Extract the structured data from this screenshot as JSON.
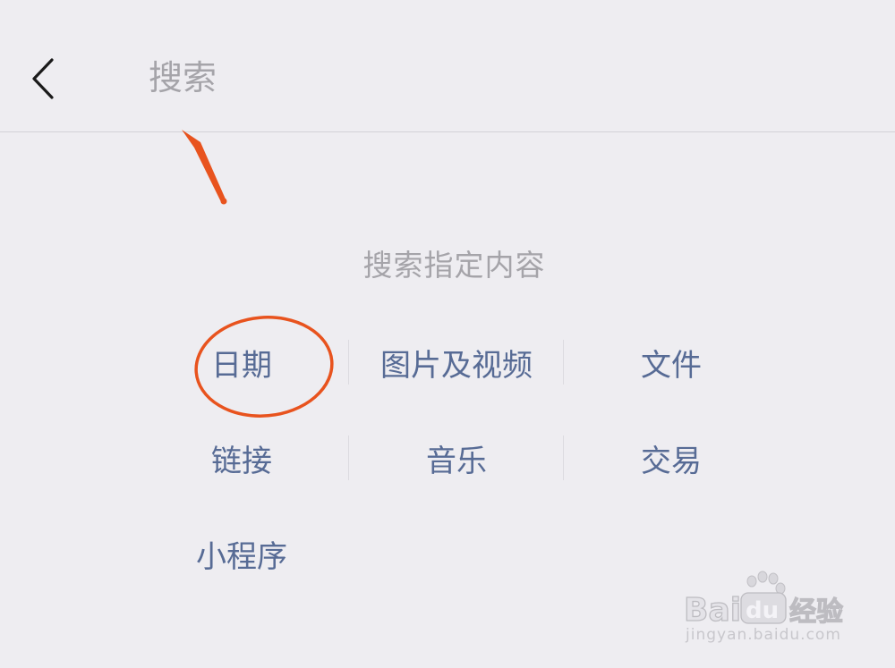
{
  "header": {
    "back_label": "",
    "search_placeholder": "搜索"
  },
  "content": {
    "subtitle": "搜索指定内容",
    "categories": [
      [
        "日期",
        "图片及视频",
        "文件"
      ],
      [
        "链接",
        "音乐",
        "交易"
      ],
      [
        "小程序"
      ]
    ]
  },
  "watermark": {
    "logo_text": "Baidu经验",
    "url": "jingyan.baidu.com"
  },
  "colors": {
    "background": "#eeedf1",
    "link": "#576b95",
    "hint": "#a5a4a9",
    "annotation": "#e8531e"
  },
  "icons": {
    "back": "chevron-left-icon",
    "annotation_arrow": "arrow-annotation-icon",
    "annotation_circle": "circle-annotation-icon",
    "watermark_paw": "paw-icon"
  }
}
